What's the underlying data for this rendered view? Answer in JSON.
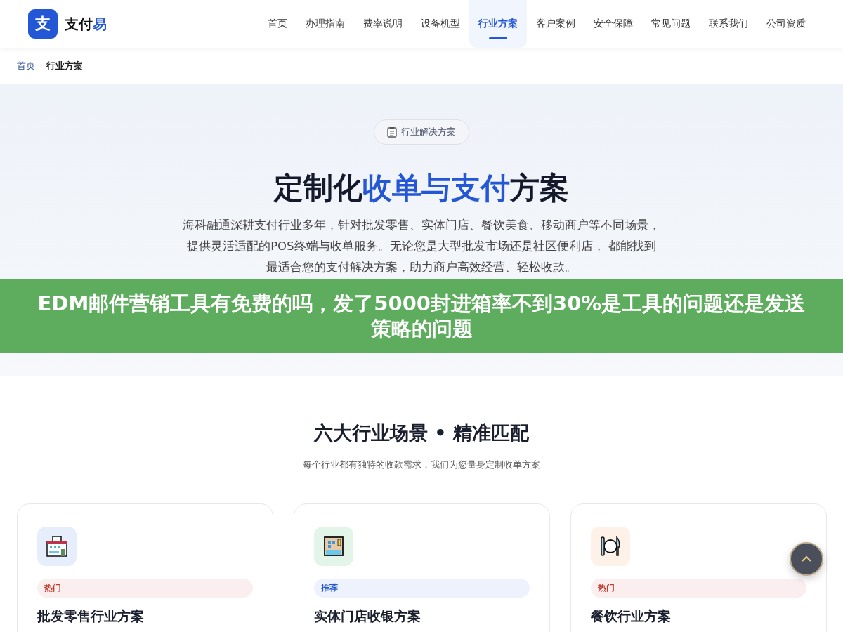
{
  "header": {
    "logo_mark": "支",
    "logo_text": "支付",
    "logo_accent": "易",
    "nav": [
      {
        "label": "首页",
        "selected": false
      },
      {
        "label": "办理指南",
        "selected": false
      },
      {
        "label": "费率说明",
        "selected": false
      },
      {
        "label": "设备机型",
        "selected": false
      },
      {
        "label": "行业方案",
        "selected": true
      },
      {
        "label": "客户案例",
        "selected": false
      },
      {
        "label": "安全保障",
        "selected": false
      },
      {
        "label": "常见问题",
        "selected": false
      },
      {
        "label": "联系我们",
        "selected": false
      },
      {
        "label": "公司资质",
        "selected": false
      }
    ]
  },
  "breadcrumb": {
    "home": "首页",
    "separator": "›",
    "current": "行业方案"
  },
  "hero": {
    "pill": "行业解决方案",
    "title_start": "定制化",
    "title_accent": "收单与支付",
    "title_end": "方案",
    "description": "海科融通深耕支付行业多年，针对批发零售、实体门店、餐饮美食、移动商户等不同场景，提供灵活适配的POS终端与收单服务。无论您是大型批发市场还是社区便利店， 都能找到最适合您的支付解决方案，助力商户高效经营、轻松收款。"
  },
  "overlay_banner": "EDM邮件营销工具有免费的吗，发了5000封进箱率不到30%是工具的问题还是发送策略的问题",
  "section": {
    "title": "六大行业场景 • 精准匹配",
    "subtitle": "每个行业都有独特的收款需求，我们为您量身定制收单方案"
  },
  "cards": [
    {
      "kind": "store",
      "tag": "热门",
      "color": "#c0392b",
      "title": "批发零售行业方案"
    },
    {
      "kind": "building",
      "tag": "推荐",
      "color": "#2457d6",
      "title": "实体门店收银方案"
    },
    {
      "kind": "dining",
      "tag": "热门",
      "color": "#c0392b",
      "title": "餐饮行业方案"
    }
  ]
}
